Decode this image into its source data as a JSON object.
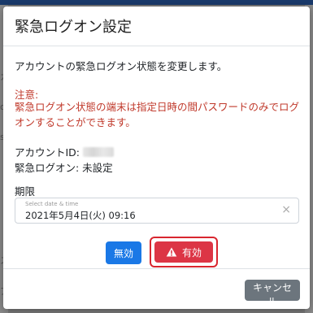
{
  "background": {
    "left_fragments": [
      "カ",
      "ot",
      "st",
      "ス",
      "アカ"
    ]
  },
  "modal": {
    "title": "緊急ログオン設定",
    "description": "アカウントの緊急ログオン状態を変更します。",
    "note_title": "注意:",
    "note_text": "緊急ログオン状態の端末は指定日時の間パスワードのみでログオンすることができます。",
    "account_label": "アカウントID:",
    "emergency_status": "緊急ログオン: 未設定",
    "period_label": "期限",
    "datetime": {
      "placeholder": "Select date & time",
      "value": "2021年5月4日(火) 09:16",
      "clear_icon": "×"
    },
    "buttons": {
      "disable": "無効",
      "enable": "有効",
      "cancel": "キャンセル"
    }
  },
  "colors": {
    "primary": "#1a78e6",
    "danger": "#dc3545",
    "highlight_border": "#d9262f",
    "note_text": "#c0392b",
    "secondary": "#6c757d"
  }
}
